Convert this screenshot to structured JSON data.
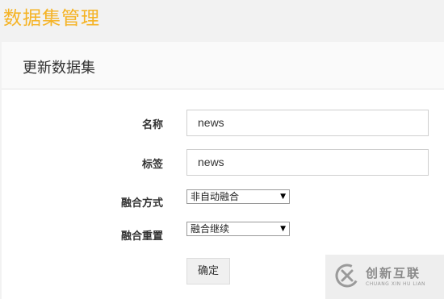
{
  "page": {
    "title": "数据集管理"
  },
  "card": {
    "title": "更新数据集"
  },
  "form": {
    "name_label": "名称",
    "name_value": "news",
    "tag_label": "标签",
    "tag_value": "news",
    "fusion_method_label": "融合方式",
    "fusion_method_value": "非自动融合",
    "fusion_reset_label": "融合重置",
    "fusion_reset_value": "融合继续",
    "confirm_label": "确定"
  },
  "watermark": {
    "cn": "创新互联",
    "en": "CHUANG XIN HU LIAN"
  },
  "colors": {
    "title": "#f5b324"
  }
}
